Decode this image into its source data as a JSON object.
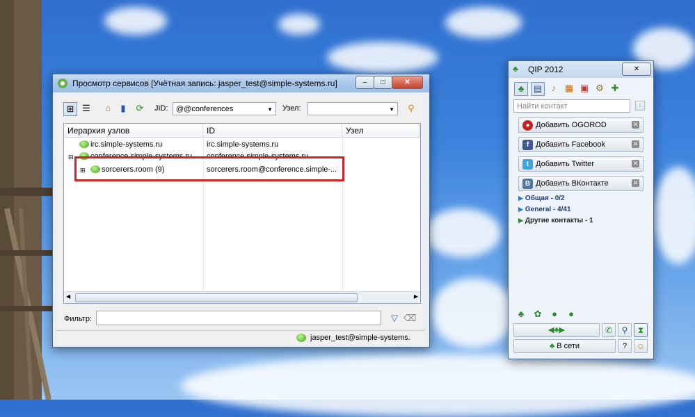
{
  "colors": {
    "highlight": "#d42121",
    "accent": "#1b3f86"
  },
  "services_window": {
    "title": "Просмотр сервисов [Учётная запись: jasper_test@simple-systems.ru]",
    "toolbar": {
      "jid_label": "JID:",
      "jid_value": "@@conferences",
      "node_label": "Узел:",
      "node_value": ""
    },
    "columns": [
      "Иерархия узлов",
      "ID",
      "Узел"
    ],
    "rows": [
      {
        "name": "irc.simple-systems.ru",
        "id": "irc.simple-systems.ru",
        "node": ""
      },
      {
        "name": "conference.simple-systems.ru",
        "id": "conference.simple-systems.ru",
        "node": ""
      },
      {
        "name": "sorcerers.room (9)",
        "id": "sorcerers.room@conference.simple-...",
        "node": ""
      }
    ],
    "filter_label": "Фильтр:",
    "filter_value": "",
    "status_account": "jasper_test@simple-systems."
  },
  "qip_window": {
    "title": "QIP 2012",
    "search_placeholder": "Найти контакт",
    "add_buttons": [
      {
        "label": "Добавить OGOROD",
        "icon": "ogorod-icon",
        "color": "#c32020"
      },
      {
        "label": "Добавить Facebook",
        "icon": "facebook-icon",
        "color": "#3b5998"
      },
      {
        "label": "Добавить Twitter",
        "icon": "twitter-icon",
        "color": "#39a6e0"
      },
      {
        "label": "Добавить ВКонтакте",
        "icon": "vkontakte-icon",
        "color": "#4a76a8"
      }
    ],
    "groups": [
      {
        "label": "Общая - 0/2"
      },
      {
        "label": "General - 4/41"
      },
      {
        "label": "Другие контакты - 1"
      }
    ],
    "status_button": "В сети",
    "help_label": "?"
  }
}
